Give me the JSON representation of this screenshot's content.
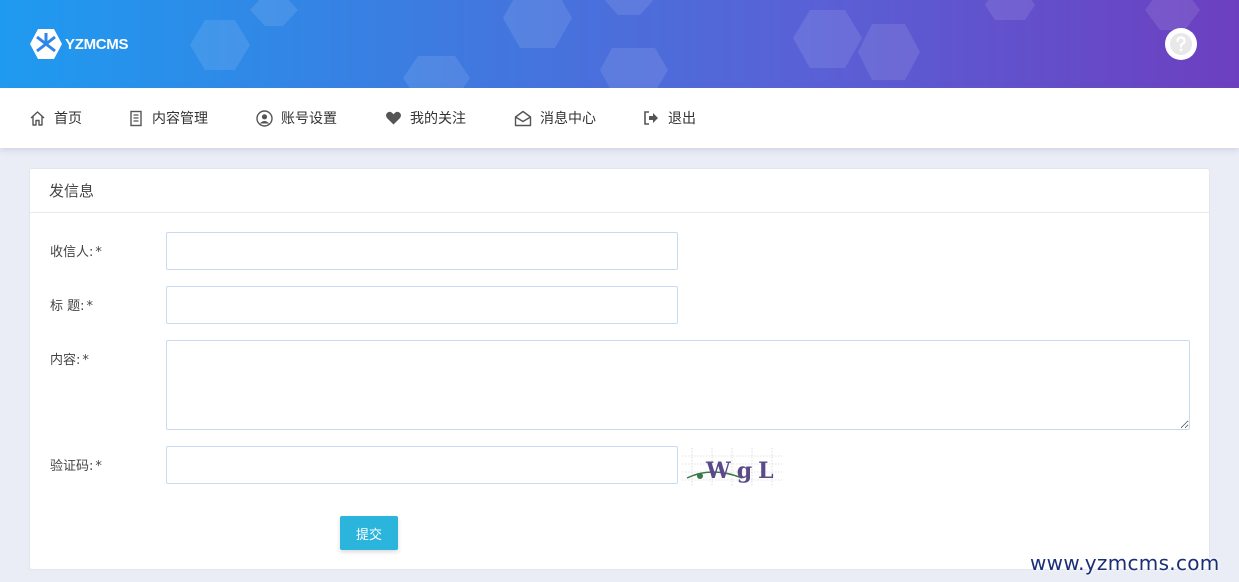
{
  "header": {
    "logo_text": "YZMCMS",
    "logo_icon": "yzmcms-logo-icon",
    "avatar_icon": "user-avatar-icon"
  },
  "nav": {
    "items": [
      {
        "label": "首页",
        "icon": "home-icon"
      },
      {
        "label": "内容管理",
        "icon": "document-icon"
      },
      {
        "label": "账号设置",
        "icon": "user-circle-icon"
      },
      {
        "label": "我的关注",
        "icon": "heart-icon"
      },
      {
        "label": "消息中心",
        "icon": "envelope-open-icon"
      },
      {
        "label": "退出",
        "icon": "sign-out-icon"
      }
    ]
  },
  "panel": {
    "title": "发信息"
  },
  "form": {
    "recipient_label": "收信人:",
    "subject_label": "标 题:",
    "content_label": "内容:",
    "captcha_label": "验证码:",
    "required_mark": "*",
    "recipient_value": "",
    "subject_value": "",
    "content_value": "",
    "captcha_value": "",
    "captcha_text": "WgL",
    "submit_label": "提交"
  },
  "watermark": "www.yzmcms.com",
  "colors": {
    "header_gradient_start": "#1e9bf0",
    "header_gradient_end": "#6c3fc0",
    "submit_button": "#2bb4dc",
    "page_background": "#eaedf6"
  }
}
